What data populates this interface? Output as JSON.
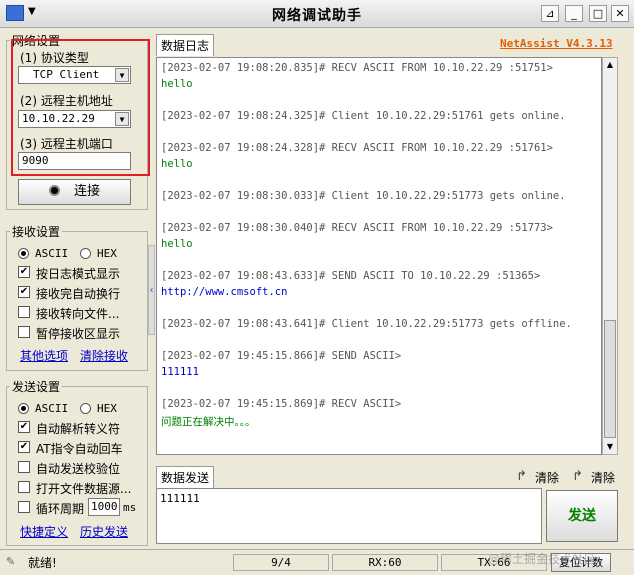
{
  "titlebar": {
    "title": "网络调试助手"
  },
  "network": {
    "group_title": "网络设置",
    "protocol_label": "(1) 协议类型",
    "protocol_value": "TCP Client",
    "host_label": "(2) 远程主机地址",
    "host_value": "10.10.22.29",
    "port_label": "(3) 远程主机端口",
    "port_value": "9090",
    "connect_label": "连接"
  },
  "receive": {
    "group_title": "接收设置",
    "ascii": "ASCII",
    "hex": "HEX",
    "options": [
      "按日志模式显示",
      "接收完自动换行",
      "接收转向文件...",
      "暂停接收区显示"
    ],
    "links": [
      "其他选项",
      "清除接收"
    ]
  },
  "send_settings": {
    "group_title": "发送设置",
    "ascii": "ASCII",
    "hex": "HEX",
    "options": [
      "自动解析转义符",
      "AT指令自动回车",
      "自动发送校验位",
      "打开文件数据源...",
      "循环周期"
    ],
    "period_value": "1000",
    "period_unit": "ms",
    "links": [
      "快捷定义",
      "历史发送"
    ]
  },
  "log_panel": {
    "tab": "数据日志",
    "brand": "NetAssist V4.3.13",
    "entries": [
      {
        "kind": "meta",
        "text": "[2023-02-07 19:08:20.835]# RECV ASCII FROM 10.10.22.29 :51751>"
      },
      {
        "kind": "recv",
        "text": "hello"
      },
      {
        "kind": "meta",
        "text": "[2023-02-07 19:08:24.325]# Client 10.10.22.29:51761 gets online."
      },
      {
        "kind": "meta",
        "text": "[2023-02-07 19:08:24.328]# RECV ASCII FROM 10.10.22.29 :51761>"
      },
      {
        "kind": "recv",
        "text": "hello"
      },
      {
        "kind": "meta",
        "text": "[2023-02-07 19:08:30.033]# Client 10.10.22.29:51773 gets online."
      },
      {
        "kind": "meta",
        "text": "[2023-02-07 19:08:30.040]# RECV ASCII FROM 10.10.22.29 :51773>"
      },
      {
        "kind": "recv",
        "text": "hello"
      },
      {
        "kind": "meta",
        "text": "[2023-02-07 19:08:43.633]# SEND ASCII TO 10.10.22.29 :51365>"
      },
      {
        "kind": "send",
        "text": "http://www.cmsoft.cn"
      },
      {
        "kind": "meta",
        "text": "[2023-02-07 19:08:43.641]# Client 10.10.22.29:51773 gets offline."
      },
      {
        "kind": "meta",
        "text": "[2023-02-07 19:45:15.866]# SEND ASCII>"
      },
      {
        "kind": "send",
        "text": "111111"
      },
      {
        "kind": "meta",
        "text": "[2023-02-07 19:45:15.869]# RECV ASCII>"
      },
      {
        "kind": "recv",
        "text": "问题正在解决中。。。"
      }
    ]
  },
  "send_panel": {
    "tab": "数据发送",
    "clear1": "清除",
    "clear2": "清除",
    "text": "111111",
    "send_label": "发送"
  },
  "status": {
    "ready": "就绪!",
    "count": "9/4",
    "rx": "RX:60",
    "tx": "TX:66",
    "reset": "复位计数",
    "watermark": "@稀土掘金技术社区"
  }
}
